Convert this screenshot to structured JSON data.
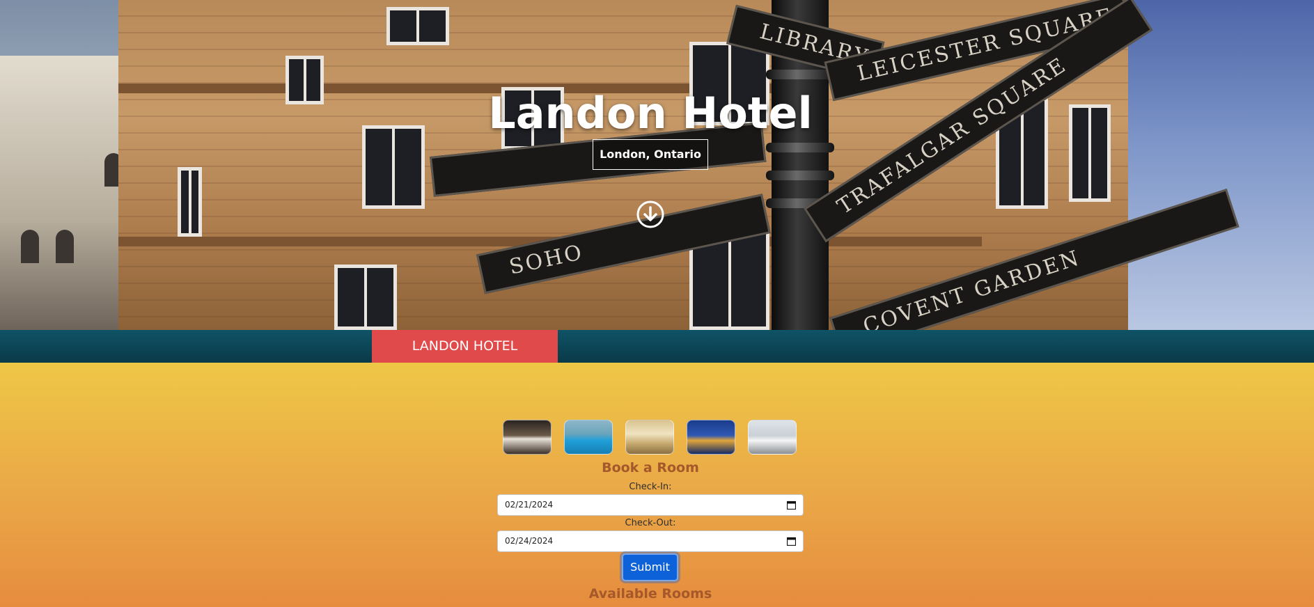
{
  "hero": {
    "title": "Landon Hotel",
    "subtitle": "London, Ontario",
    "scroll_icon": "arrow-down-circle-icon",
    "signs": [
      "LIBRARY",
      "LEICESTER SQUARE",
      "TRAFALGAR SQUARE",
      "SOHO",
      "COVENT GARDEN"
    ]
  },
  "nav": {
    "brand": "LANDON HOTEL"
  },
  "gallery": {
    "thumbnails": [
      "lobby-thumbnail",
      "pool-thumbnail",
      "ballroom-thumbnail",
      "london-skyline-thumbnail",
      "wedding-thumbnail"
    ]
  },
  "booking": {
    "title": "Book a Room",
    "checkin_label": "Check-In:",
    "checkin_value": "02/21/2024",
    "checkout_label": "Check-Out:",
    "checkout_value": "02/24/2024",
    "submit_label": "Submit"
  },
  "rooms": {
    "title": "Available Rooms"
  },
  "colors": {
    "nav_bg": "#0a3a48",
    "brand_bg": "#e04a4a",
    "accent_button": "#0d62d9",
    "heading_text": "#a5582a"
  }
}
